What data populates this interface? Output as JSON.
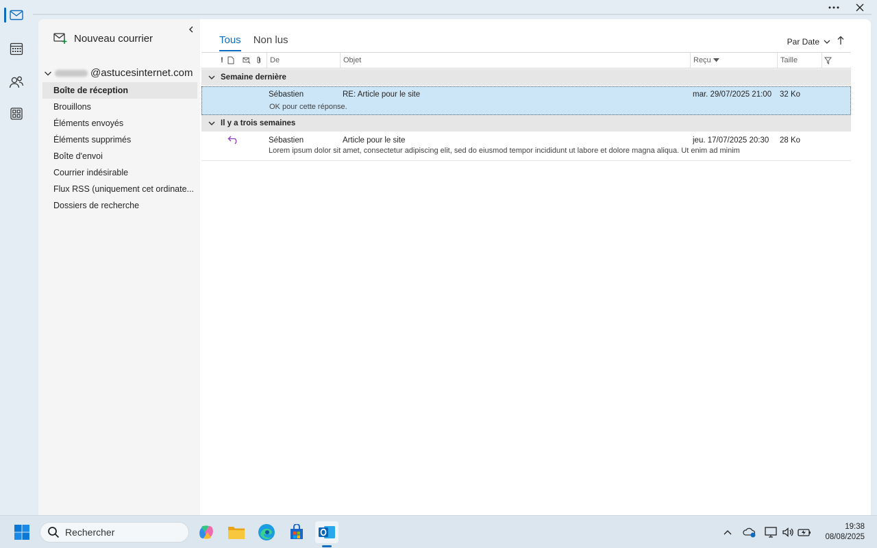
{
  "rail": {
    "items": [
      {
        "name": "mail-icon",
        "active": true
      },
      {
        "name": "calendar-icon",
        "active": false
      },
      {
        "name": "people-icon",
        "active": false
      },
      {
        "name": "apps-icon",
        "active": false
      }
    ]
  },
  "folder_pane": {
    "new_mail_label": "Nouveau courrier",
    "account_suffix": "@astucesinternet.com",
    "folders": [
      {
        "label": "Boîte de réception",
        "selected": true
      },
      {
        "label": "Brouillons"
      },
      {
        "label": "Éléments envoyés"
      },
      {
        "label": "Éléments supprimés"
      },
      {
        "label": "Boîte d'envoi"
      },
      {
        "label": "Courrier indésirable"
      },
      {
        "label": "Flux RSS (uniquement cet ordinate..."
      },
      {
        "label": "Dossiers de recherche"
      }
    ]
  },
  "list": {
    "tabs": [
      "Tous",
      "Non lus"
    ],
    "sort_label": "Par Date",
    "columns": {
      "importance": "!",
      "from": "De",
      "subject": "Objet",
      "received": "Reçu",
      "size": "Taille"
    },
    "groups": [
      {
        "label": "Semaine dernière",
        "messages": [
          {
            "from": "Sébastien",
            "subject": "RE: Article pour le site",
            "received": "mar. 29/07/2025 21:00",
            "size": "32 Ko",
            "preview": "OK pour cette réponse.",
            "selected": true,
            "replied": false
          }
        ]
      },
      {
        "label": "Il y a trois semaines",
        "messages": [
          {
            "from": "Sébastien",
            "subject": "Article pour le site",
            "received": "jeu. 17/07/2025 20:30",
            "size": "28 Ko",
            "preview": "Lorem ipsum dolor sit amet, consectetur adipiscing elit, sed do eiusmod tempor incididunt ut labore et dolore magna aliqua. Ut enim ad minim",
            "selected": false,
            "replied": true
          }
        ]
      }
    ]
  },
  "taskbar": {
    "search_placeholder": "Rechercher",
    "time": "19:38",
    "date": "08/08/2025"
  },
  "colors": {
    "accent": "#0f6cbd",
    "selected_row": "#cde6f7",
    "reply_icon": "#8a3fb8"
  }
}
